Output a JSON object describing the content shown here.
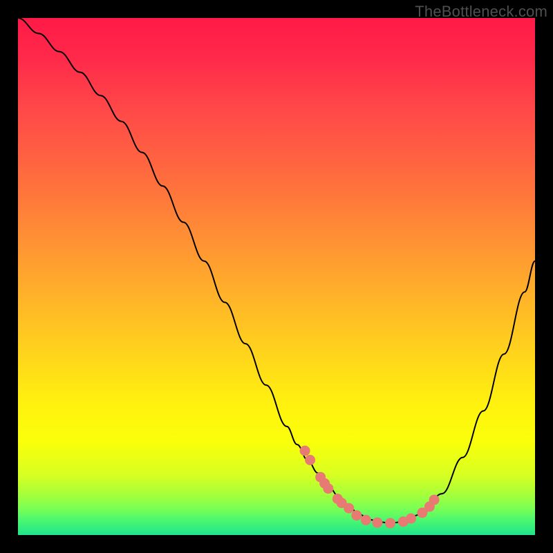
{
  "watermark": "TheBottleneck.com",
  "colors": {
    "background": "#000000",
    "curve": "#000000",
    "dot": "#e77a73",
    "gradient_top": "#ff1a47",
    "gradient_bottom": "#22e38c"
  },
  "chart_data": {
    "type": "line",
    "title": "",
    "xlabel": "",
    "ylabel": "",
    "xlim": [
      0,
      100
    ],
    "ylim": [
      0,
      100
    ],
    "x": [
      0,
      4,
      8,
      12,
      16,
      20,
      24,
      28,
      32,
      36,
      40,
      44,
      48,
      52,
      54,
      56,
      58,
      60,
      62,
      64,
      66,
      68,
      70,
      72,
      74,
      78,
      82,
      86,
      90,
      94,
      98,
      100
    ],
    "y": [
      100,
      97,
      93.5,
      89.5,
      85,
      80,
      74,
      67.5,
      60.5,
      53,
      45,
      37,
      29,
      21,
      17.5,
      14.5,
      12,
      9.5,
      7.5,
      5.5,
      4,
      3,
      2.5,
      2.3,
      2.5,
      4,
      8,
      15,
      24,
      35,
      47,
      53
    ],
    "markers": {
      "x": [
        55.5,
        56.5,
        58.5,
        59.3,
        60,
        61.8,
        62.6,
        64,
        65.5,
        67.3,
        69.5,
        72,
        74.5,
        76,
        78.2,
        79.6,
        80.5
      ],
      "y": [
        16.3,
        14.5,
        11.2,
        10,
        9,
        7,
        6.2,
        5.2,
        3.8,
        2.9,
        2.4,
        2.3,
        2.6,
        3.2,
        4.3,
        5.5,
        6.8
      ]
    }
  }
}
